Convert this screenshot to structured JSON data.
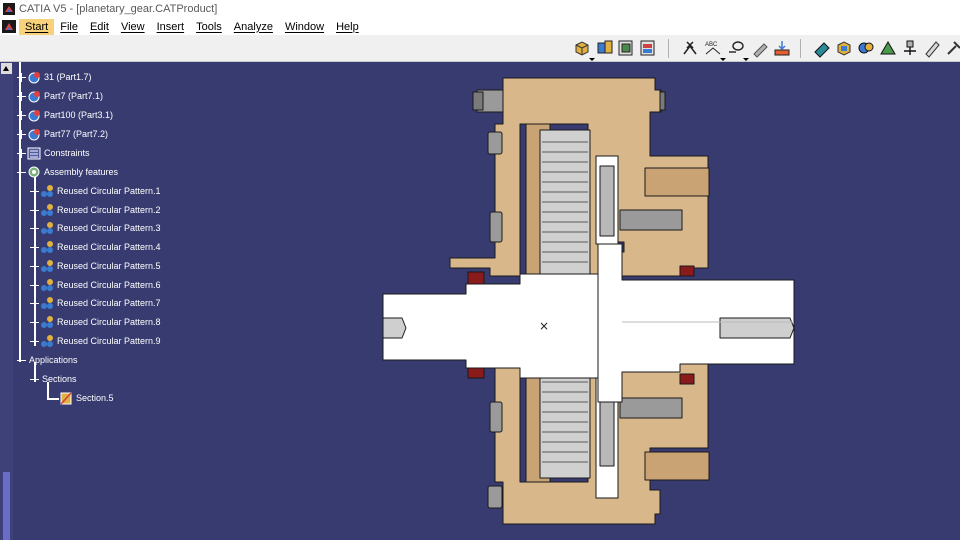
{
  "window": {
    "title": "CATIA V5 - [planetary_gear.CATProduct]"
  },
  "menu": {
    "items": [
      {
        "label": "Start",
        "active": true
      },
      {
        "label": "File",
        "active": false
      },
      {
        "label": "Edit",
        "active": false
      },
      {
        "label": "View",
        "active": false
      },
      {
        "label": "Insert",
        "active": false
      },
      {
        "label": "Tools",
        "active": false
      },
      {
        "label": "Analyze",
        "active": false
      },
      {
        "label": "Window",
        "active": false
      },
      {
        "label": "Help",
        "active": false
      }
    ]
  },
  "toolbar": {
    "icons": [
      "product-icon",
      "component-icon",
      "part-add-icon",
      "existing-component-icon",
      "fix-constraint-icon",
      "offset-constraint-icon",
      "angle-constraint-icon",
      "manipulate-icon",
      "snap-icon",
      "measure-icon",
      "section-icon",
      "clash-icon",
      "space-analysis-icon",
      "explode-icon",
      "assembly-features-icon",
      "tools-icon"
    ]
  },
  "tree": {
    "nodes": [
      {
        "label": "31 (Part1.7)",
        "icon": "part-icon",
        "expanded": false
      },
      {
        "label": "Part7 (Part7.1)",
        "icon": "part-icon",
        "expanded": false
      },
      {
        "label": "Part100 (Part3.1)",
        "icon": "part-icon",
        "expanded": false
      },
      {
        "label": "Part77 (Part7.2)",
        "icon": "part-icon",
        "expanded": false
      },
      {
        "label": "Constraints",
        "icon": "constraints-icon",
        "expanded": false
      },
      {
        "label": "Assembly features",
        "icon": "assembly-features-icon",
        "expanded": true
      },
      {
        "label": "Reused Circular Pattern.1",
        "icon": "pattern-icon",
        "expanded": false
      },
      {
        "label": "Reused Circular Pattern.2",
        "icon": "pattern-icon",
        "expanded": false
      },
      {
        "label": "Reused Circular Pattern.3",
        "icon": "pattern-icon",
        "expanded": false
      },
      {
        "label": "Reused Circular Pattern.4",
        "icon": "pattern-icon",
        "expanded": false
      },
      {
        "label": "Reused Circular Pattern.5",
        "icon": "pattern-icon",
        "expanded": false
      },
      {
        "label": "Reused Circular Pattern.6",
        "icon": "pattern-icon",
        "expanded": false
      },
      {
        "label": "Reused Circular Pattern.7",
        "icon": "pattern-icon",
        "expanded": false
      },
      {
        "label": "Reused Circular Pattern.8",
        "icon": "pattern-icon",
        "expanded": false
      },
      {
        "label": "Reused Circular Pattern.9",
        "icon": "pattern-icon",
        "expanded": false
      },
      {
        "label": "Applications",
        "icon": "",
        "expanded": true
      },
      {
        "label": "Sections",
        "icon": "",
        "expanded": true
      },
      {
        "label": "Section.5",
        "icon": "section-icon",
        "expanded": false
      }
    ]
  },
  "viewport": {
    "background": "#383b70",
    "colors": {
      "casing": "#d8b88a",
      "shaft": "#ffffff",
      "gear": "#c8c8c8",
      "bolt": "#9a9a9a",
      "seal": "#8b1a1a"
    },
    "compass_marker": "×"
  }
}
